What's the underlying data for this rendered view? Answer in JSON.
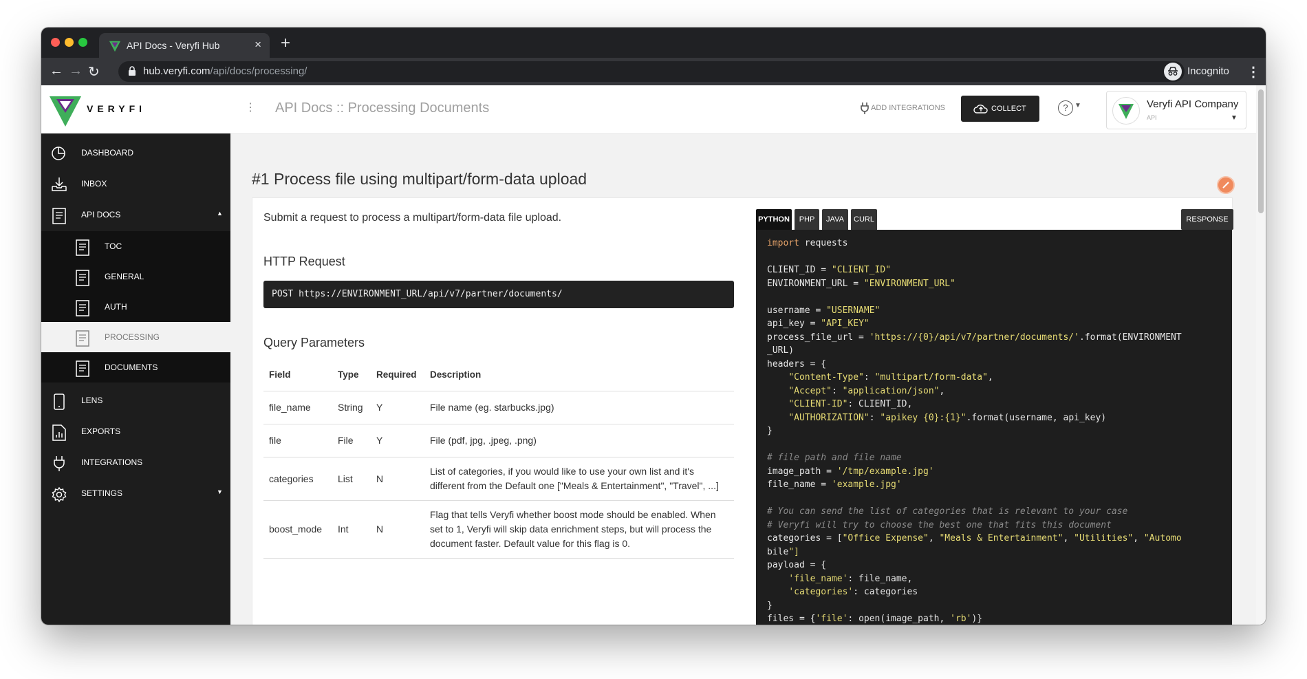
{
  "browser": {
    "tab_title": "API Docs - Veryfi Hub",
    "url_host": "hub.veryfi.com",
    "url_path": "/api/docs/processing/",
    "profile_label": "Incognito"
  },
  "header": {
    "logo_text": "VERYFI",
    "page_title": "API Docs :: Processing Documents",
    "add_integrations_label": "ADD INTEGRATIONS",
    "collect_label": "COLLECT",
    "help_label": "?",
    "company_name": "Veryfi API Company",
    "company_sub": "API"
  },
  "sidebar": {
    "items": [
      {
        "label": "DASHBOARD",
        "icon": "chart-pie-icon"
      },
      {
        "label": "INBOX",
        "icon": "inbox-download-icon"
      },
      {
        "label": "API DOCS",
        "icon": "document-icon",
        "expanded": true
      },
      {
        "label": "TOC",
        "icon": "document-icon"
      },
      {
        "label": "GENERAL",
        "icon": "document-icon"
      },
      {
        "label": "AUTH",
        "icon": "document-icon"
      },
      {
        "label": "PROCESSING",
        "icon": "document-icon",
        "active": true
      },
      {
        "label": "DOCUMENTS",
        "icon": "document-icon"
      },
      {
        "label": "LENS",
        "icon": "phone-icon"
      },
      {
        "label": "EXPORTS",
        "icon": "file-chart-icon"
      },
      {
        "label": "INTEGRATIONS",
        "icon": "plug-icon"
      },
      {
        "label": "SETTINGS",
        "icon": "gear-icon"
      }
    ]
  },
  "main": {
    "section_title": "#1 Process file using multipart/form-data upload",
    "description": "Submit a request to process a multipart/form-data file upload.",
    "http_request_heading": "HTTP Request",
    "endpoint": "POST https://ENVIRONMENT_URL/api/v7/partner/documents/",
    "query_params_heading": "Query Parameters",
    "table": {
      "headers": [
        "Field",
        "Type",
        "Required",
        "Description"
      ],
      "rows": [
        [
          "file_name",
          "String",
          "Y",
          "File name (eg. starbucks.jpg)"
        ],
        [
          "file",
          "File",
          "Y",
          "File (pdf, jpg, .jpeg, .png)"
        ],
        [
          "categories",
          "List",
          "N",
          "List of categories, if you would like to use your own list and it's different from the Default one [\"Meals & Entertainment\", \"Travel\", ...]"
        ],
        [
          "boost_mode",
          "Int",
          "N",
          "Flag that tells Veryfi whether boost mode should be enabled. When set to 1, Veryfi will skip data enrichment steps, but will process the document faster. Default value for this flag is 0."
        ]
      ]
    },
    "code_tabs": [
      "PYTHON",
      "PHP",
      "JAVA",
      "CURL"
    ],
    "active_code_tab": "PYTHON",
    "response_label": "RESPONSE",
    "code_lines": [
      "import requests",
      "",
      "CLIENT_ID = \"CLIENT_ID\"",
      "ENVIRONMENT_URL = \"ENVIRONMENT_URL\"",
      "",
      "username = \"USERNAME\"",
      "api_key = \"API_KEY\"",
      "process_file_url = 'https://{0}/api/v7/partner/documents/'.format(ENVIRONMENT",
      "_URL)",
      "headers = {",
      "    \"Content-Type\": \"multipart/form-data\",",
      "    \"Accept\": \"application/json\",",
      "    \"CLIENT-ID\": CLIENT_ID,",
      "    \"AUTHORIZATION\": \"apikey {0}:{1}\".format(username, api_key)",
      "}",
      "",
      "# file path and file name",
      "image_path = '/tmp/example.jpg'",
      "file_name = 'example.jpg'",
      "",
      "# You can send the list of categories that is relevant to your case",
      "# Veryfi will try to choose the best one that fits this document",
      "categories = [\"Office Expense\", \"Meals & Entertainment\", \"Utilities\", \"Automo",
      "bile\"]",
      "payload = {",
      "    'file_name': file_name,",
      "    'categories': categories",
      "}",
      "files = {'file': open(image_path, 'rb')}"
    ]
  },
  "colors": {
    "brand_green": "#3fae5a",
    "brand_purple": "#6b2d8a",
    "sidebar_bg": "#1d1d1d",
    "code_bg": "#1e1e1e",
    "accent_orange": "#f08a5d"
  }
}
